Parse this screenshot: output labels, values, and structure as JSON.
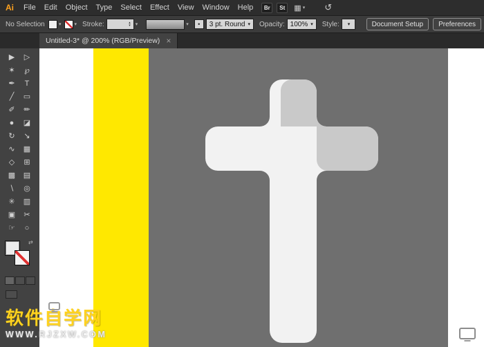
{
  "app": {
    "logo": "Ai"
  },
  "menubar": {
    "items": [
      "File",
      "Edit",
      "Object",
      "Type",
      "Select",
      "Effect",
      "View",
      "Window",
      "Help"
    ],
    "bridge": "Br",
    "stock": "St"
  },
  "controlbar": {
    "selection_status": "No Selection",
    "stroke_label": "Stroke:",
    "brush_name": "3 pt. Round",
    "opacity_label": "Opacity:",
    "opacity_value": "100%",
    "style_label": "Style:",
    "document_setup_button": "Document Setup",
    "preferences_button": "Preferences"
  },
  "tabbar": {
    "tab_title": "Untitled-3* @ 200% (RGB/Preview)",
    "close": "×"
  },
  "toolbar": {
    "tools": [
      {
        "name": "selection-tool",
        "glyph": "▶"
      },
      {
        "name": "direct-selection-tool",
        "glyph": "▷"
      },
      {
        "name": "magic-wand-tool",
        "glyph": "✶"
      },
      {
        "name": "lasso-tool",
        "glyph": "℘"
      },
      {
        "name": "pen-tool",
        "glyph": "✒"
      },
      {
        "name": "type-tool",
        "glyph": "T"
      },
      {
        "name": "line-segment-tool",
        "glyph": "╱"
      },
      {
        "name": "rectangle-tool",
        "glyph": "▭"
      },
      {
        "name": "paintbrush-tool",
        "glyph": "✐"
      },
      {
        "name": "pencil-tool",
        "glyph": "✏"
      },
      {
        "name": "blob-brush-tool",
        "glyph": "●"
      },
      {
        "name": "eraser-tool",
        "glyph": "◪"
      },
      {
        "name": "rotate-tool",
        "glyph": "↻"
      },
      {
        "name": "scale-tool",
        "glyph": "↘"
      },
      {
        "name": "width-tool",
        "glyph": "∿"
      },
      {
        "name": "free-transform-tool",
        "glyph": "▦"
      },
      {
        "name": "shape-builder-tool",
        "glyph": "◇"
      },
      {
        "name": "perspective-grid-tool",
        "glyph": "⊞"
      },
      {
        "name": "mesh-tool",
        "glyph": "▩"
      },
      {
        "name": "gradient-tool",
        "glyph": "▤"
      },
      {
        "name": "eyedropper-tool",
        "glyph": "∖"
      },
      {
        "name": "blend-tool",
        "glyph": "◎"
      },
      {
        "name": "symbol-sprayer-tool",
        "glyph": "✳"
      },
      {
        "name": "column-graph-tool",
        "glyph": "▥"
      },
      {
        "name": "artboard-tool",
        "glyph": "▣"
      },
      {
        "name": "slice-tool",
        "glyph": "✂"
      },
      {
        "name": "hand-tool",
        "glyph": "☞"
      },
      {
        "name": "zoom-tool",
        "glyph": "○"
      }
    ]
  },
  "canvas": {
    "watermark_title": "软件自学网",
    "watermark_url": "WWW.RJZXW.COM"
  },
  "icons": {
    "caret_down": "▾",
    "stepper_up": "▴",
    "stepper_down": "▾",
    "dot": "•",
    "swap": "⇄",
    "workspace": "▦",
    "sync": "↺"
  },
  "colors": {
    "accent_orange": "#ffa21f",
    "artboard_white": "#ffffff",
    "stripe_yellow": "#ffe800",
    "background_gray": "#6f6f6f",
    "cross_white": "#f2f2f2",
    "cross_highlight": "#c9c9c9",
    "watermark_yellow": "#ffd21e"
  }
}
